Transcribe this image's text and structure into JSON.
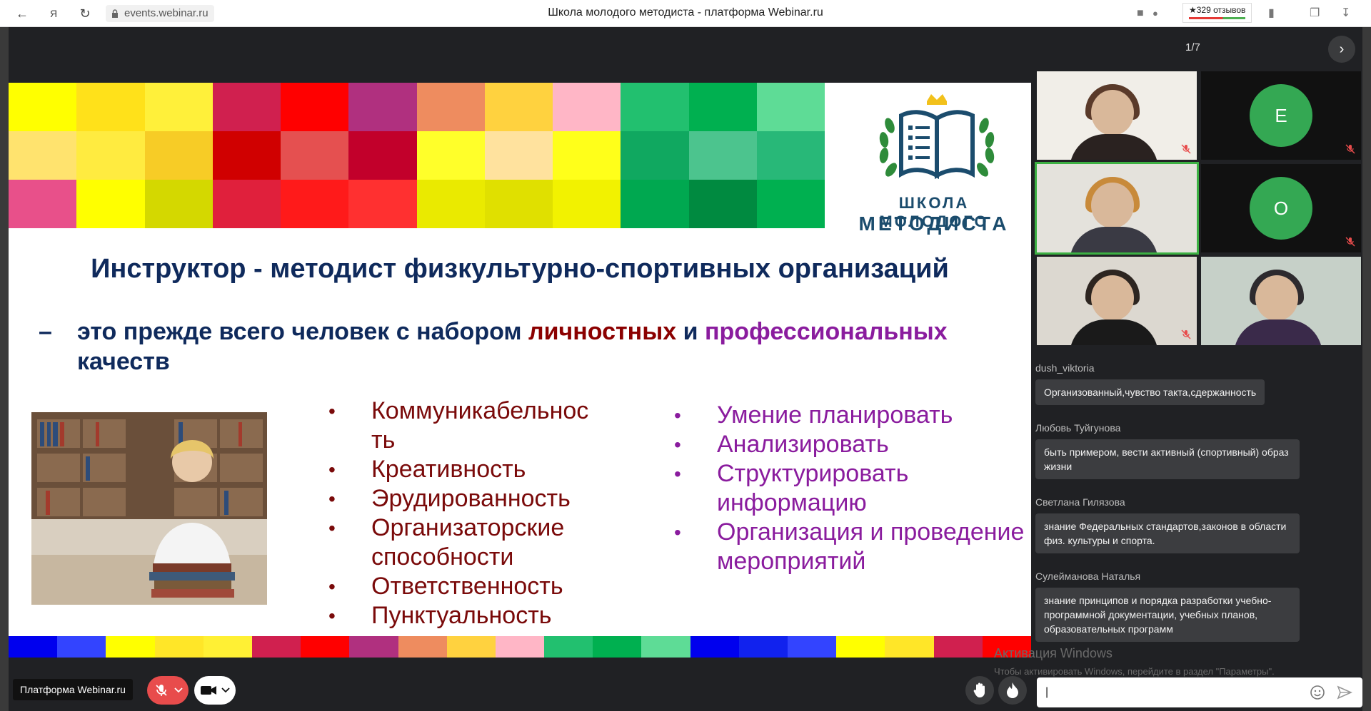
{
  "browser": {
    "url": "events.webinar.ru",
    "title": "Школа молодого методиста - платформа Webinar.ru",
    "reviews_label": "★329 отзывов"
  },
  "slide": {
    "counter": "1/7",
    "logo_line1": "ШКОЛА МОЛОДОГО",
    "logo_line2": "МЕТОДИСТА",
    "title": "Инструктор - методист физкультурно-спортивных организаций",
    "subtitle": {
      "dash": "–",
      "before": "это прежде всего человек с набором ",
      "w1": "личностных",
      "and": " и ",
      "w2": "профессиональных",
      "after": " качеств"
    },
    "bullet": "•",
    "left_list": [
      "Коммуникабельнос ть",
      "Креативность",
      "Эрудированность",
      "Организаторские способности",
      "Ответственность",
      "Пунктуальность"
    ],
    "right_list": [
      "Умение планировать",
      "Анализировать",
      "Структурировать информацию",
      "Организация и проведение мероприятий"
    ],
    "mosaic_colors": [
      "#ffff00",
      "#ffe11a",
      "#fff03a",
      "#d0204f",
      "#ff0000",
      "#b0307f",
      "#ee8c5f",
      "#ffd23f",
      "#ffb6c6",
      "#22c06f",
      "#00b050",
      "#5edc96",
      "#ffe36e",
      "#ffeb40",
      "#f7cc26",
      "#d00000",
      "#e55050",
      "#c2002b",
      "#ffff2a",
      "#ffe29e",
      "#ffff1a",
      "#10a860",
      "#4cc48e",
      "#28b878",
      "#e8508a",
      "#ffff00",
      "#d4d800",
      "#e0203c",
      "#ff1a1a",
      "#ff3030",
      "#eaea00",
      "#e0e000",
      "#f2f200",
      "#00a850",
      "#008a40",
      "#00b050"
    ],
    "strip_colors": [
      "#0000ee",
      "#3344ff",
      "#ffff00",
      "#ffe628",
      "#fff034",
      "#d0204f",
      "#ff0000",
      "#b0307f",
      "#ee8c5f",
      "#ffd23f",
      "#ffb6c6",
      "#22c06f",
      "#00b050",
      "#5edc96",
      "#0000ee",
      "#1122ee",
      "#3344ff",
      "#ffff00",
      "#ffe628",
      "#d0204f",
      "#ff0000"
    ]
  },
  "participants": [
    {
      "type": "video",
      "active": false,
      "muted": true
    },
    {
      "type": "avatar",
      "initial": "Е",
      "muted": true
    },
    {
      "type": "video",
      "active": true,
      "muted": false
    },
    {
      "type": "avatar",
      "initial": "О",
      "muted": true
    },
    {
      "type": "video",
      "active": false,
      "muted": true
    },
    {
      "type": "video",
      "active": false,
      "muted": false
    }
  ],
  "chat": {
    "messages": [
      {
        "author": "dush_viktoria",
        "text": "Организованный,чувство такта,сдержанность"
      },
      {
        "author": "Любовь Туйгунова",
        "text": "быть примером, вести активный (спортивный) образ жизни"
      },
      {
        "author": "Светлана Гилязова",
        "text": "знание Федеральных стандартов,законов в области физ. культуры и спорта."
      },
      {
        "author": "Сулейманова Наталья",
        "text": "знание принципов и порядка разработки учебно-программной документации, учебных планов, образовательных программ"
      }
    ],
    "input_value": "|"
  },
  "watermark": {
    "line1": "Активация Windows",
    "line2": "Чтобы активировать Windows, перейдите в раздел \"Параметры\"."
  },
  "bottom": {
    "brand": "Платформа Webinar.ru"
  },
  "colors": {
    "mic_off_red": "#e84c4c",
    "avatar_green": "#34a853",
    "active_border": "#3cb043"
  }
}
